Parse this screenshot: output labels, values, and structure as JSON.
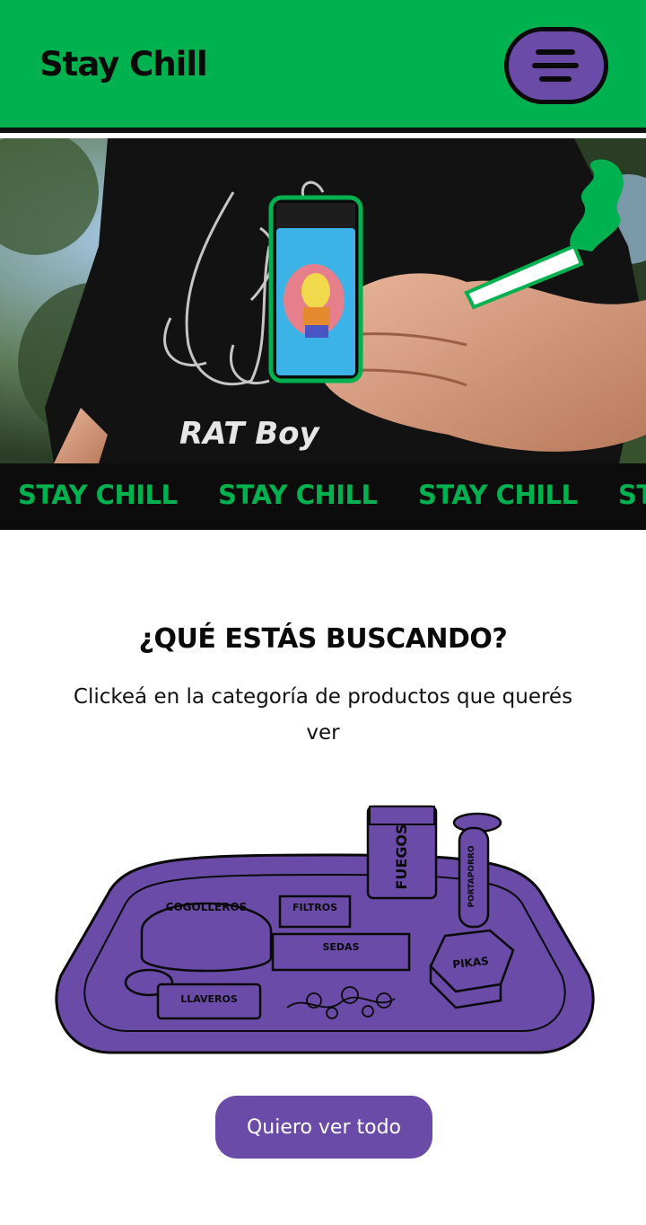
{
  "header": {
    "brand": "Stay Chill",
    "menu_icon": "hamburger-menu-icon",
    "bg_color": "#00b14f",
    "accent_color": "#6a4ca8"
  },
  "hero": {
    "shirt_text": "RAT Boy"
  },
  "ticker": {
    "items": [
      "STAY CHILL",
      "STAY CHILL",
      "STAY CHILL",
      "STAY CHILL"
    ],
    "text_color": "#00b14f"
  },
  "categories_section": {
    "title": "¿QUÉ ESTÁS BUSCANDO?",
    "subtitle": "Clickeá en la categoría de productos que querés ver",
    "tray_items": {
      "cogolleros": "COGOLLEROS",
      "filtros": "FILTROS",
      "fuegos": "FUEGOS",
      "portaporro": "PORTAPORRO",
      "sedas": "SEDAS",
      "pikas": "PIKAS",
      "llaveros": "LLAVEROS"
    }
  },
  "cta": {
    "label": "Quiero ver todo"
  }
}
